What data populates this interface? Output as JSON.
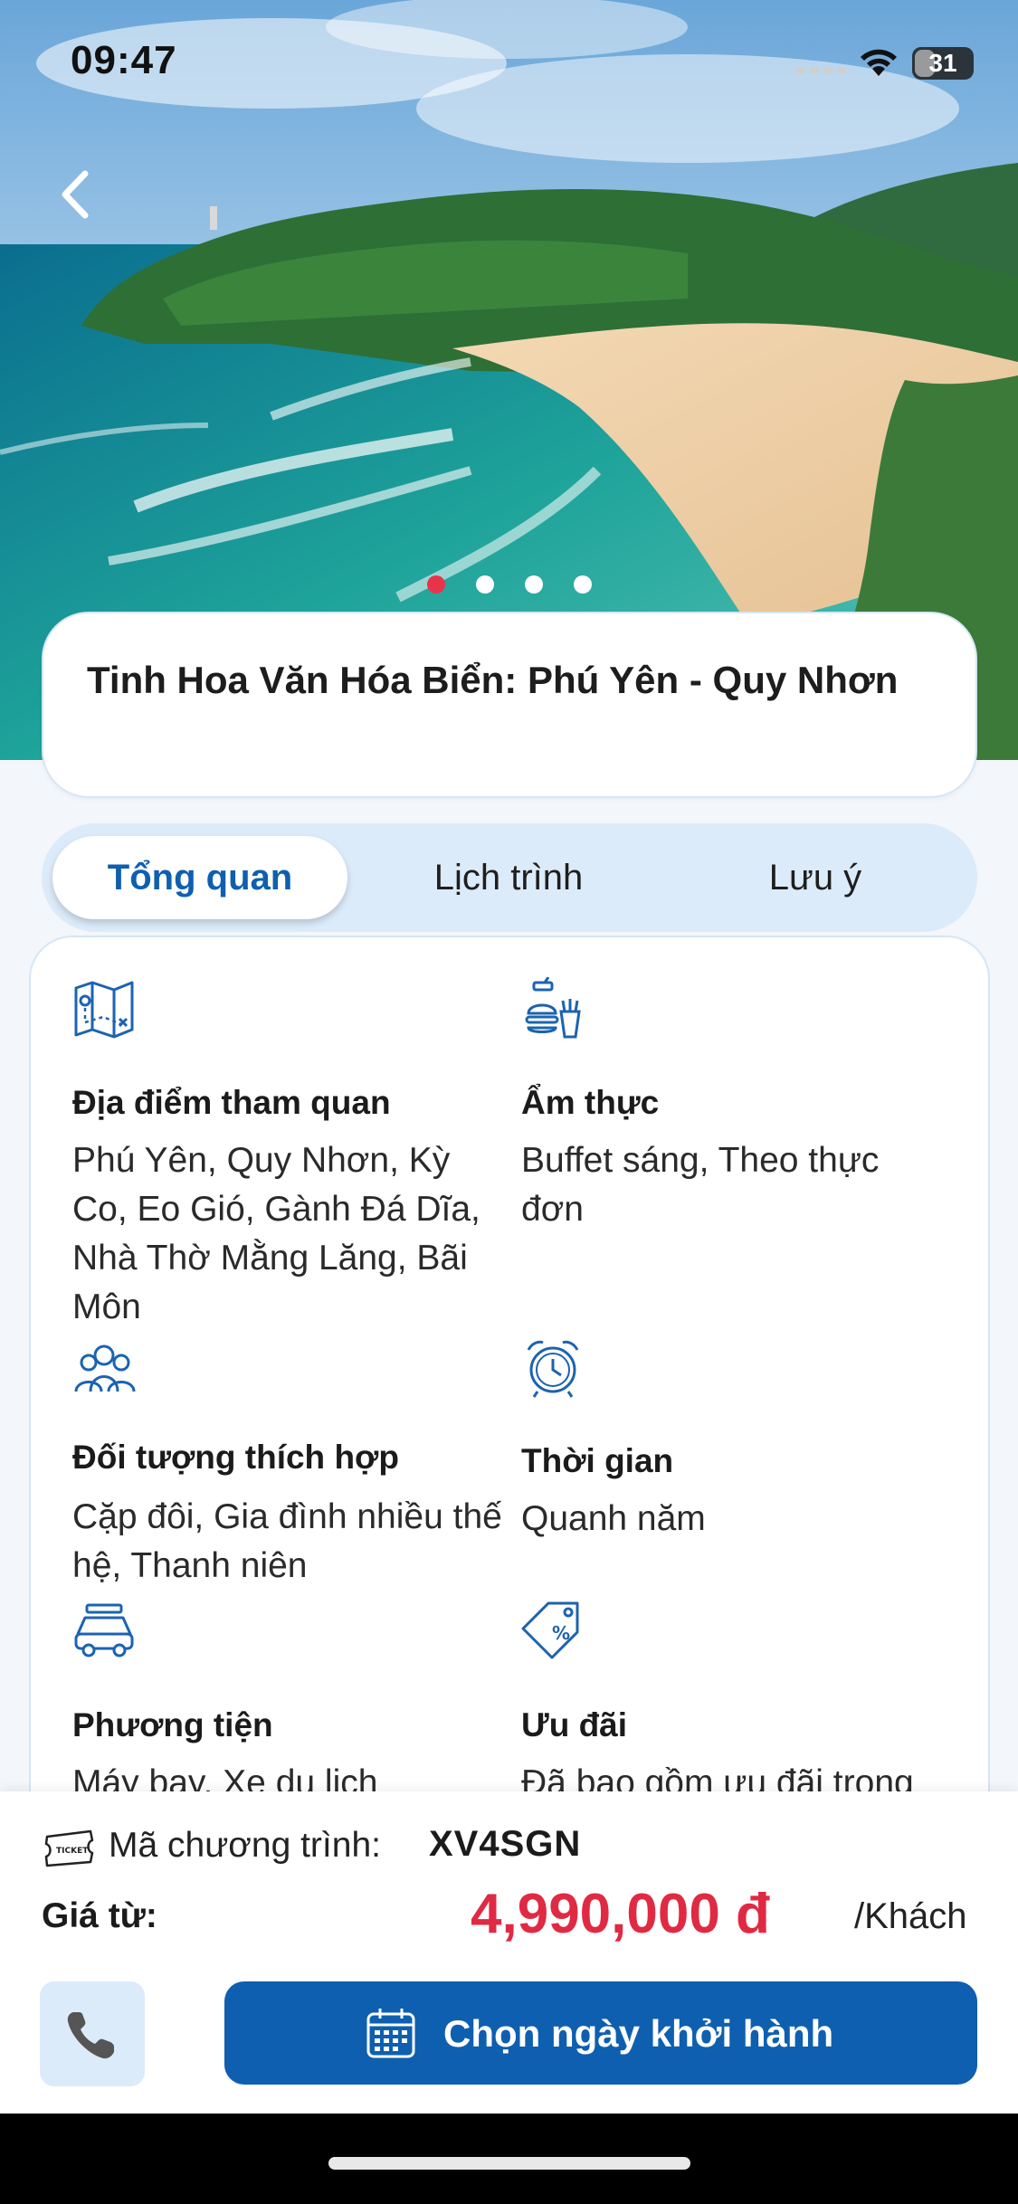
{
  "status_bar": {
    "time": "09:47",
    "battery": "31"
  },
  "hero": {
    "slide_count": 4,
    "active_slide": 1
  },
  "tour": {
    "title": "Tinh Hoa Văn Hóa Biển: Phú Yên - Quy Nhơn"
  },
  "tabs": [
    {
      "label": "Tổng quan",
      "active": true
    },
    {
      "label": "Lịch trình",
      "active": false
    },
    {
      "label": "Lưu ý",
      "active": false
    }
  ],
  "overview": {
    "places": {
      "title": "Địa điểm tham quan",
      "value": "Phú Yên, Quy Nhơn, Kỳ Co, Eo Gió, Gành Đá Dĩa, Nhà Thờ Mằng Lăng, Bãi Môn",
      "icon": "map-icon"
    },
    "cuisine": {
      "title": "Ẩm thực",
      "value": "Buffet sáng, Theo thực đơn",
      "icon": "food-icon"
    },
    "audience": {
      "title": "Đối tượng thích hợp",
      "value": "Cặp đôi, Gia đình nhiều thế hệ, Thanh niên",
      "icon": "people-icon"
    },
    "time": {
      "title": "Thời gian",
      "value": "Quanh năm",
      "icon": "alarm-clock-icon"
    },
    "transport": {
      "title": "Phương tiện",
      "value": "Máy bay, Xe du lịch",
      "icon": "car-icon"
    },
    "offers": {
      "title": "Ưu đãi",
      "value": "Đã bao gồm ưu đãi trong giá tour",
      "icon": "discount-tag-icon"
    }
  },
  "booking": {
    "code_label": "Mã chương trình:",
    "code_value": "XV4SGN",
    "price_label": "Giá từ:",
    "price_value": "4,990,000 đ",
    "price_unit": "/Khách",
    "cta_label": "Chọn ngày khởi hành"
  },
  "colors": {
    "primary": "#0e5fb0",
    "price": "#e02a43",
    "tab_bg": "#dcebfa"
  }
}
